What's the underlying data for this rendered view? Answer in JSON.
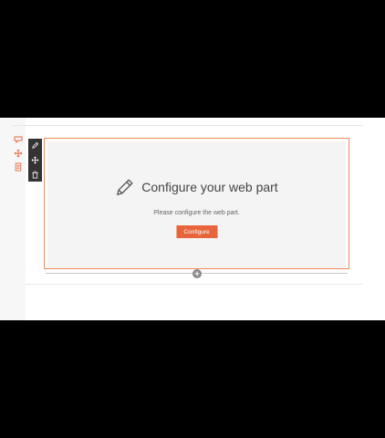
{
  "placeholder": {
    "title": "Configure your web part",
    "description": "Please configure the web part.",
    "button_label": "Configure",
    "icon": "pencil-icon"
  },
  "section_toolbar": {
    "items": [
      {
        "icon": "edit-section-icon"
      },
      {
        "icon": "move-section-icon"
      },
      {
        "icon": "delete-section-icon"
      }
    ]
  },
  "webpart_toolbar": {
    "items": [
      {
        "icon": "edit-icon"
      },
      {
        "icon": "move-icon"
      },
      {
        "icon": "delete-icon"
      }
    ]
  },
  "add_control": {
    "icon": "plus-icon"
  },
  "colors": {
    "accent": "#e8643a",
    "selection_border": "#f18a60",
    "toolbar_bg": "#333333",
    "placeholder_bg": "#f4f4f4",
    "frame_bg": "#000000"
  }
}
